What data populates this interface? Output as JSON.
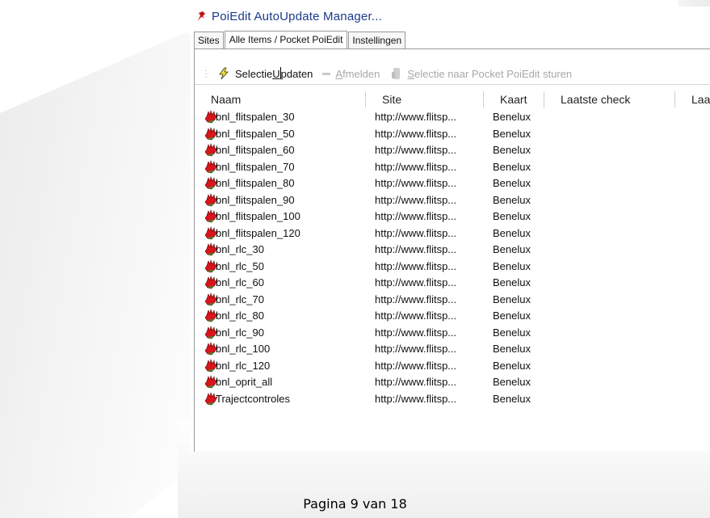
{
  "window": {
    "title": "PoiEdit AutoUpdate Manager...",
    "tabs": [
      {
        "label": "Sites"
      },
      {
        "label": "Alle Items / Pocket PoiEdit"
      },
      {
        "label": "Instellingen"
      }
    ],
    "toolbar": {
      "update_label_pre": "Selectie ",
      "update_label_ul": "U",
      "update_label_post": "pdaten",
      "unsubscribe_label_ul": "A",
      "unsubscribe_label_post": "fmelden",
      "send_label_ul": "S",
      "send_label_post": "electie naar Pocket PoiEdit sturen"
    },
    "columns": [
      "Naam",
      "Site",
      "Kaart",
      "Laatste check",
      "Laa"
    ],
    "items": [
      {
        "name": "bnl_flitspalen_30",
        "site": "http://www.flitsp...",
        "map": "Benelux"
      },
      {
        "name": "bnl_flitspalen_50",
        "site": "http://www.flitsp...",
        "map": "Benelux"
      },
      {
        "name": "bnl_flitspalen_60",
        "site": "http://www.flitsp...",
        "map": "Benelux"
      },
      {
        "name": "bnl_flitspalen_70",
        "site": "http://www.flitsp...",
        "map": "Benelux"
      },
      {
        "name": "bnl_flitspalen_80",
        "site": "http://www.flitsp...",
        "map": "Benelux"
      },
      {
        "name": "bnl_flitspalen_90",
        "site": "http://www.flitsp...",
        "map": "Benelux"
      },
      {
        "name": "bnl_flitspalen_100",
        "site": "http://www.flitsp...",
        "map": "Benelux"
      },
      {
        "name": "bnl_flitspalen_120",
        "site": "http://www.flitsp...",
        "map": "Benelux"
      },
      {
        "name": "bnl_rlc_30",
        "site": "http://www.flitsp...",
        "map": "Benelux"
      },
      {
        "name": "bnl_rlc_50",
        "site": "http://www.flitsp...",
        "map": "Benelux"
      },
      {
        "name": "bnl_rlc_60",
        "site": "http://www.flitsp...",
        "map": "Benelux"
      },
      {
        "name": "bnl_rlc_70",
        "site": "http://www.flitsp...",
        "map": "Benelux"
      },
      {
        "name": "bnl_rlc_80",
        "site": "http://www.flitsp...",
        "map": "Benelux"
      },
      {
        "name": "bnl_rlc_90",
        "site": "http://www.flitsp...",
        "map": "Benelux"
      },
      {
        "name": "bnl_rlc_100",
        "site": "http://www.flitsp...",
        "map": "Benelux"
      },
      {
        "name": "bnl_rlc_120",
        "site": "http://www.flitsp...",
        "map": "Benelux"
      },
      {
        "name": "bnl_oprit_all",
        "site": "http://www.flitsp...",
        "map": "Benelux"
      },
      {
        "name": "Trajectcontroles",
        "site": "http://www.flitsp...",
        "map": "Benelux"
      }
    ]
  },
  "footer": {
    "page_label": "Pagina 9 van 18"
  },
  "colors": {
    "title": "#1b3a8a",
    "item_icon": "#d8141c"
  }
}
